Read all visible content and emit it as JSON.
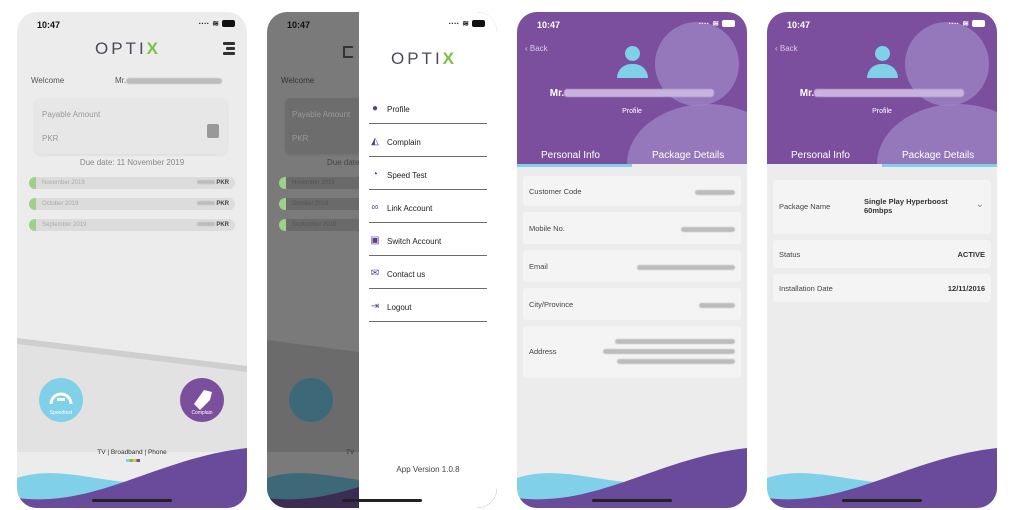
{
  "status": {
    "time": "10:47"
  },
  "brand": {
    "logo_text": "OPTI",
    "logo_x": "X"
  },
  "screen1": {
    "welcome_label": "Welcome",
    "user_prefix": "Mr.",
    "payable_label": "Payable Amount",
    "currency": "PKR",
    "due_date": "Due date: 11 November 2019",
    "history": [
      {
        "month": "November 2019",
        "amount": "PKR"
      },
      {
        "month": "October 2019",
        "amount": "PKR"
      },
      {
        "month": "September 2019",
        "amount": "PKR"
      }
    ],
    "speedtest_label": "Speedtest",
    "complain_label": "Complain",
    "services": "TV | Broadband | Phone",
    "accent": "#7b4f9e"
  },
  "screen2": {
    "menu": [
      {
        "label": "Profile",
        "icon": "person-icon"
      },
      {
        "label": "Complain",
        "icon": "megaphone-icon"
      },
      {
        "label": "Speed Test",
        "icon": "speedometer-icon"
      },
      {
        "label": "Link Account",
        "icon": "link-icon"
      },
      {
        "label": "Switch Account",
        "icon": "switch-icon"
      },
      {
        "label": "Contact us",
        "icon": "mail-icon"
      },
      {
        "label": "Logout",
        "icon": "logout-icon"
      }
    ],
    "app_version": "App Version 1.0.8"
  },
  "screen3": {
    "back": "Back",
    "name_prefix": "Mr.",
    "profile_label": "Profile",
    "tabs": [
      "Personal Info",
      "Package Details"
    ],
    "fields": [
      "Customer Code",
      "Mobile No.",
      "Email",
      "City/Province",
      "Address"
    ]
  },
  "screen4": {
    "back": "Back",
    "name_prefix": "Mr.",
    "profile_label": "Profile",
    "tabs": [
      "Personal Info",
      "Package Details"
    ],
    "package_label": "Package Name",
    "package_value": "Single Play Hyperboost 60mbps",
    "status_label": "Status",
    "status_value": "ACTIVE",
    "install_label": "Installation Date",
    "install_value": "12/11/2016"
  },
  "colors": {
    "purple": "#7b4f9e",
    "light_blue": "#7fd0e8",
    "green": "#7bc043"
  }
}
